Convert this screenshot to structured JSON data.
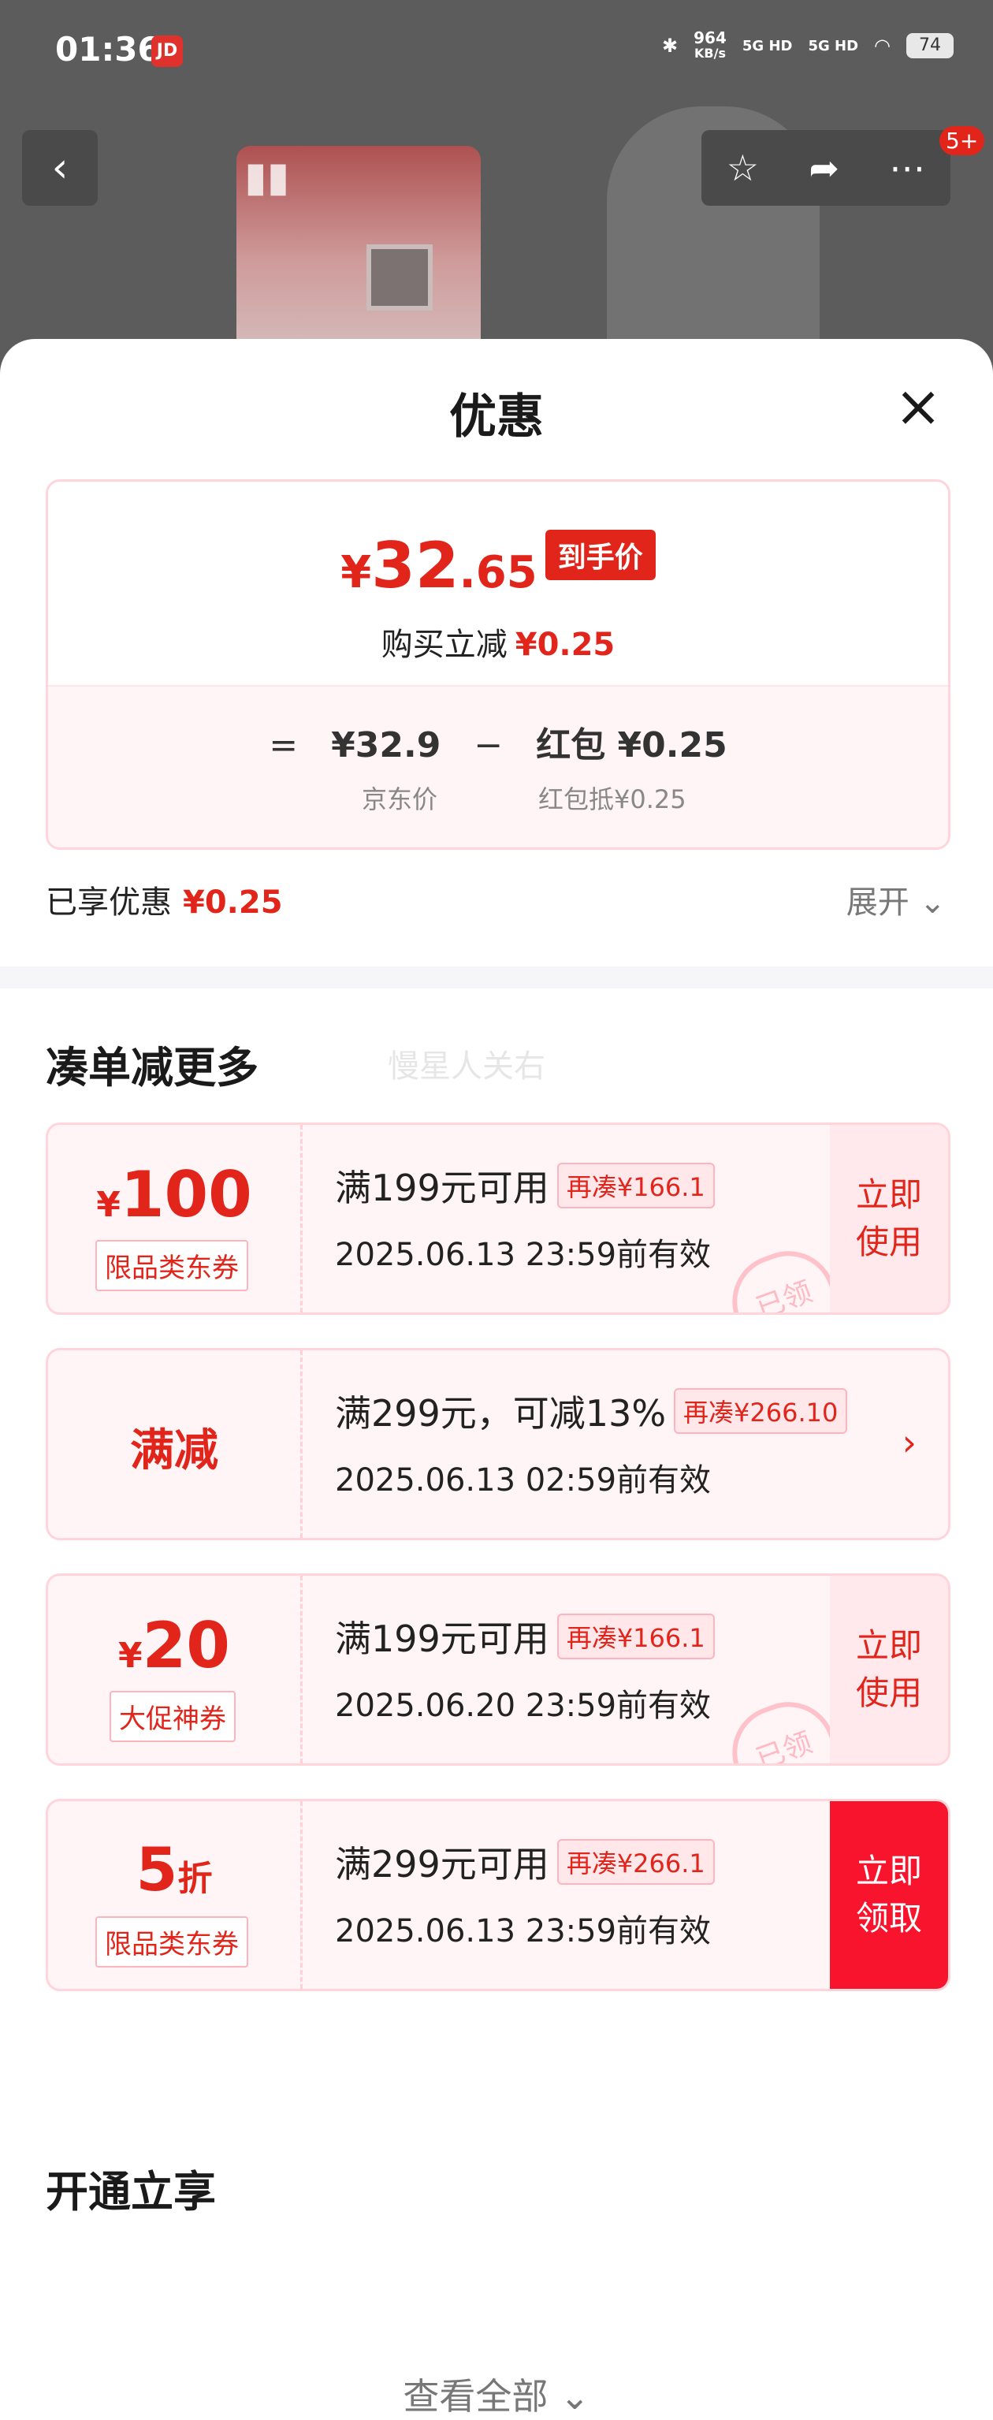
{
  "status_bar": {
    "time": "01:36",
    "app_badge": "JD",
    "speed_value": "964",
    "speed_unit": "KB/s",
    "sig1": "5G HD",
    "sig2": "5G HD",
    "battery": "74"
  },
  "nav": {
    "cart_badge": "5+"
  },
  "sheet": {
    "title": "优惠",
    "price": {
      "symbol": "¥",
      "integer": "32",
      "decimal": ".65",
      "tag": "到手价",
      "reduce_label": "购买立减",
      "reduce_amount": "¥0.25"
    },
    "formula": {
      "eq": "=",
      "jd_price": "¥32.9",
      "minus": "−",
      "redpacket": "红包 ¥0.25",
      "jd_price_label": "京东价",
      "redpacket_label": "红包抵¥0.25"
    },
    "enjoyed": {
      "label": "已享优惠",
      "amount": "¥0.25",
      "expand": "展开"
    }
  },
  "more": {
    "title": "凑单减更多",
    "watermark": "慢星人关右"
  },
  "coupons": [
    {
      "amount_sym": "¥",
      "amount": "100",
      "category": "限品类东券",
      "condition": "满199元可用",
      "need": "再凑¥166.1",
      "validity": "2025.06.13 23:59前有效",
      "action": "立即\n使用",
      "stamp": "已领"
    },
    {
      "amount": "满减",
      "condition": "满299元，可减13%",
      "need": "再凑¥266.10",
      "validity": "2025.06.13 02:59前有效"
    },
    {
      "amount_sym": "¥",
      "amount": "20",
      "category": "大促神券",
      "condition": "满199元可用",
      "need": "再凑¥166.1",
      "validity": "2025.06.20 23:59前有效",
      "action": "立即\n使用",
      "stamp": "已领"
    },
    {
      "amount": "5",
      "suffix": "折",
      "category": "限品类东券",
      "condition": "满299元可用",
      "need": "再凑¥266.1",
      "validity": "2025.06.13 23:59前有效",
      "action": "立即\n领取"
    }
  ],
  "view_all": "查看全部",
  "member": {
    "title": "开通立享"
  }
}
